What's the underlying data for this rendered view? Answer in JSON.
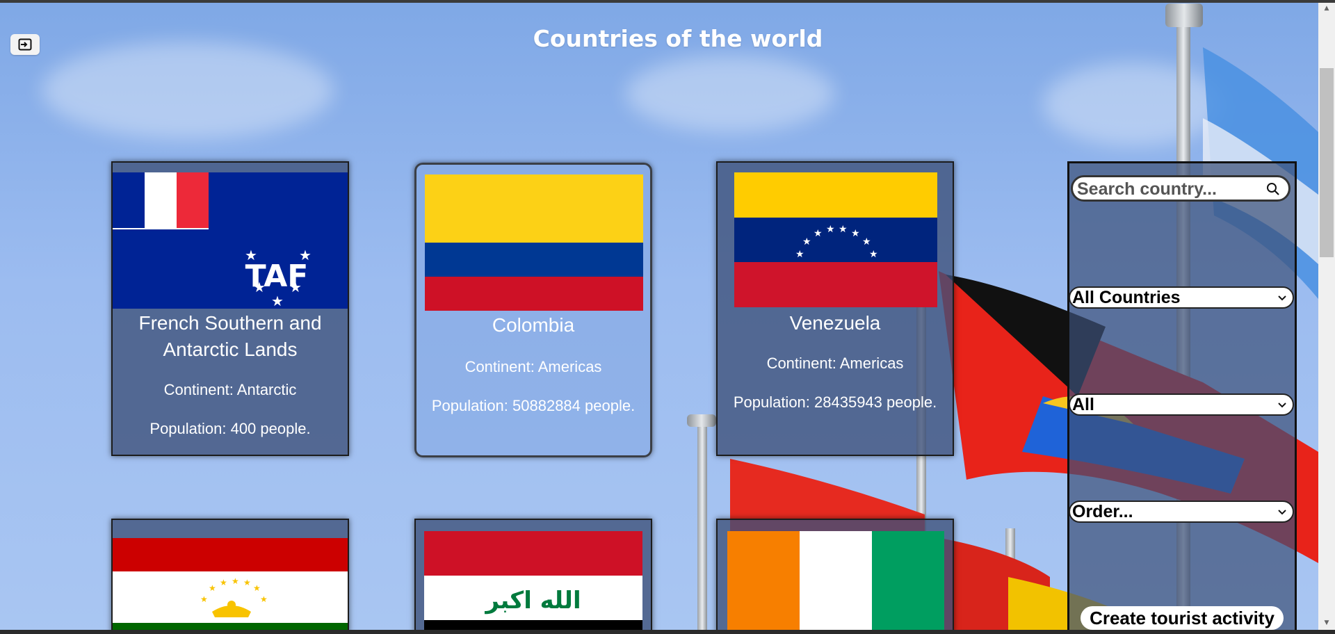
{
  "header": {
    "title": "Countries of the world",
    "logout_icon": "logout-icon"
  },
  "cards": [
    {
      "name": "French Southern and Antarctic Lands",
      "continent": "Continent: Antarctic",
      "population": "Population: 400 people."
    },
    {
      "name": "Colombia",
      "continent": "Continent: Americas",
      "population": "Population: 50882884 people."
    },
    {
      "name": "Venezuela",
      "continent": "Continent: Americas",
      "population": "Population: 28435943 people."
    }
  ],
  "flags_row2": [
    "Tajikistan",
    "Iraq",
    "Ivory Coast"
  ],
  "flag_text": {
    "iraq": "الله اكبر"
  },
  "sidebar": {
    "search_placeholder": "Search country...",
    "filter_countries": "All Countries",
    "filter_activity": "All",
    "order": "Order...",
    "create_button": "Create tourist activity"
  },
  "colors": {
    "card_bg": "#3c5078",
    "colombia_yellow": "#fcd116",
    "colombia_blue": "#003893",
    "colombia_red": "#ce1126",
    "venezuela_yellow": "#ffcc00",
    "venezuela_blue": "#00247d",
    "venezuela_red": "#cf142b"
  }
}
